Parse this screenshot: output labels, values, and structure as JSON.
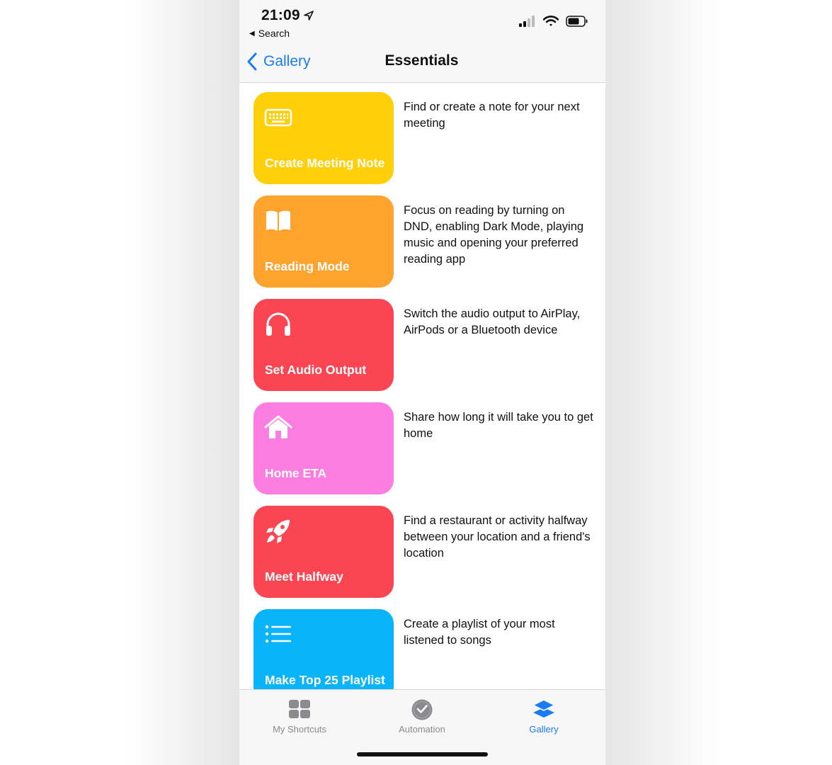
{
  "status_bar": {
    "time": "21:09",
    "back_to_app": "Search",
    "icons": [
      "location-arrow-icon",
      "cellular-signal-icon",
      "wifi-icon",
      "battery-icon"
    ]
  },
  "nav": {
    "back_label": "Gallery",
    "title": "Essentials"
  },
  "shortcuts": [
    {
      "title": "Create Meeting Note",
      "icon": "keyboard-icon",
      "color": "#ffcf0a",
      "description": "Find or create a note for your next meeting"
    },
    {
      "title": "Reading Mode",
      "icon": "book-icon",
      "color": "#ffa22e",
      "description": "Focus on reading by turning on DND, enabling Dark Mode, playing music and opening your preferred reading app"
    },
    {
      "title": "Set Audio Output",
      "icon": "headphones-icon",
      "color": "#fc4552",
      "description": "Switch the audio output to AirPlay, AirPods or a Bluetooth device"
    },
    {
      "title": "Home ETA",
      "icon": "house-icon",
      "color": "#fd7ee0",
      "description": "Share how long it will take you to get home"
    },
    {
      "title": "Meet Halfway",
      "icon": "rocket-icon",
      "color": "#fc4552",
      "description": "Find a restaurant or activity halfway between your location and a friend's location"
    },
    {
      "title": "Make Top 25 Playlist",
      "icon": "list-icon",
      "color": "#0ab4fb",
      "description": "Create a playlist of your most listened to songs"
    }
  ],
  "tab_bar": {
    "tabs": [
      {
        "label": "My Shortcuts",
        "icon": "grid-icon",
        "active": false
      },
      {
        "label": "Automation",
        "icon": "clock-check-icon",
        "active": false
      },
      {
        "label": "Gallery",
        "icon": "layers-icon",
        "active": true
      }
    ]
  },
  "colors": {
    "accent": "#1a7cf5",
    "bar_background": "#f7f7f7",
    "inactive_tab": "#8a8a8f"
  }
}
